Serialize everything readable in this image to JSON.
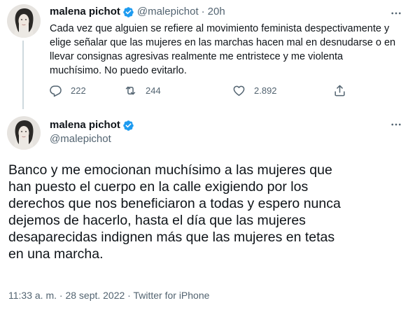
{
  "colors": {
    "text": "#0f1419",
    "muted": "#536471",
    "verified": "#1d9bf0",
    "thread_line": "#cfd9de"
  },
  "icons": {
    "verified": "verified-badge-icon",
    "more": "more-options-icon",
    "reply": "reply-icon",
    "retweet": "retweet-icon",
    "like": "like-icon",
    "share": "share-icon"
  },
  "parent_tweet": {
    "author_name": "malena pichot",
    "handle": "@malepichot",
    "separator": "·",
    "time": "20h",
    "text": "Cada vez que alguien se refiere al movimiento feminista despectivamente y\nelige señalar que las mujeres en las marchas hacen mal en desnudarse o en\nllevar consignas agresivas realmente me entristece y me violenta\nmuchísimo. No puedo evitarlo.",
    "reply_count": "222",
    "retweet_count": "244",
    "like_count": "2.892"
  },
  "main_tweet": {
    "author_name": "malena pichot",
    "handle": "@malepichot",
    "text": "Banco y me emocionan muchísimo a las mujeres que\nhan puesto el cuerpo en la calle exigiendo por los\nderechos que nos beneficiaron a todas y espero nunca\ndejemos de hacerlo, hasta el día que las mujeres\ndesaparecidas indignen más que las mujeres en tetas\nen una marcha.",
    "timestamp": "11:33 a. m. · 28 sept. 2022 · Twitter for iPhone"
  }
}
